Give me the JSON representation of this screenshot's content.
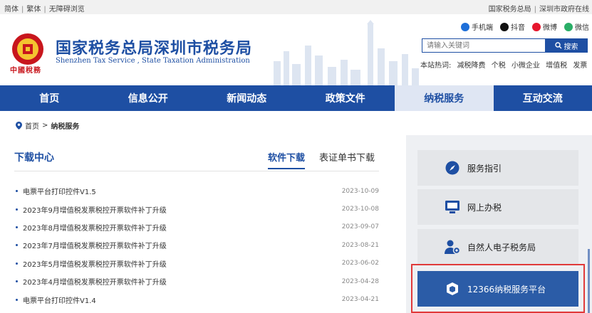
{
  "topbar": {
    "lang_simplified": "简体",
    "lang_traditional": "繁体",
    "accessible": "无障碍浏览",
    "link_state": "国家税务总局",
    "link_city": "深圳市政府在线"
  },
  "header": {
    "emblem_text": "中國稅務",
    "title": "国家税务总局深圳市税务局",
    "subtitle": "Shenzhen Tax Service , State Taxation Administration",
    "social": [
      {
        "label": "手机端",
        "icon": "mobile-icon",
        "color": "#1e6fd9"
      },
      {
        "label": "抖音",
        "icon": "douyin-icon",
        "color": "#111111"
      },
      {
        "label": "微博",
        "icon": "weibo-icon",
        "color": "#e6162d"
      },
      {
        "label": "微信",
        "icon": "wechat-icon",
        "color": "#2aae67"
      }
    ],
    "search": {
      "placeholder": "请输入关键词",
      "button": "搜索"
    },
    "hot_label": "本站热词:",
    "hot_words": [
      "减税降费",
      "个税",
      "小微企业",
      "增值税",
      "发票"
    ]
  },
  "nav": {
    "items": [
      "首页",
      "信息公开",
      "新闻动态",
      "政策文件",
      "纳税服务",
      "互动交流"
    ],
    "active": "纳税服务"
  },
  "breadcrumb": {
    "home": "首页",
    "sep": ">",
    "current": "纳税服务"
  },
  "download": {
    "title": "下载中心",
    "tabs": [
      "软件下载",
      "表证单书下载"
    ],
    "active_tab": "软件下载",
    "items": [
      {
        "name": "电票平台打印控件V1.5",
        "date": "2023-10-09"
      },
      {
        "name": "2023年9月增值税发票税控开票软件补丁升级",
        "date": "2023-10-08"
      },
      {
        "name": "2023年8月增值税发票税控开票软件补丁升级",
        "date": "2023-09-07"
      },
      {
        "name": "2023年7月增值税发票税控开票软件补丁升级",
        "date": "2023-08-21"
      },
      {
        "name": "2023年5月增值税发票税控开票软件补丁升级",
        "date": "2023-06-02"
      },
      {
        "name": "2023年4月增值税发票税控开票软件补丁升级",
        "date": "2023-04-28"
      },
      {
        "name": "电票平台打印控件V1.4",
        "date": "2023-04-21"
      }
    ]
  },
  "services": [
    {
      "label": "服务指引",
      "icon": "compass-icon"
    },
    {
      "label": "网上办税",
      "icon": "monitor-icon"
    },
    {
      "label": "自然人电子税务局",
      "icon": "person-icon"
    },
    {
      "label": "12366纳税服务平台",
      "icon": "cube-icon"
    }
  ],
  "colors": {
    "brand": "#1e4fa3",
    "accent_red": "#c8161d",
    "highlight": "#e03a3a"
  }
}
